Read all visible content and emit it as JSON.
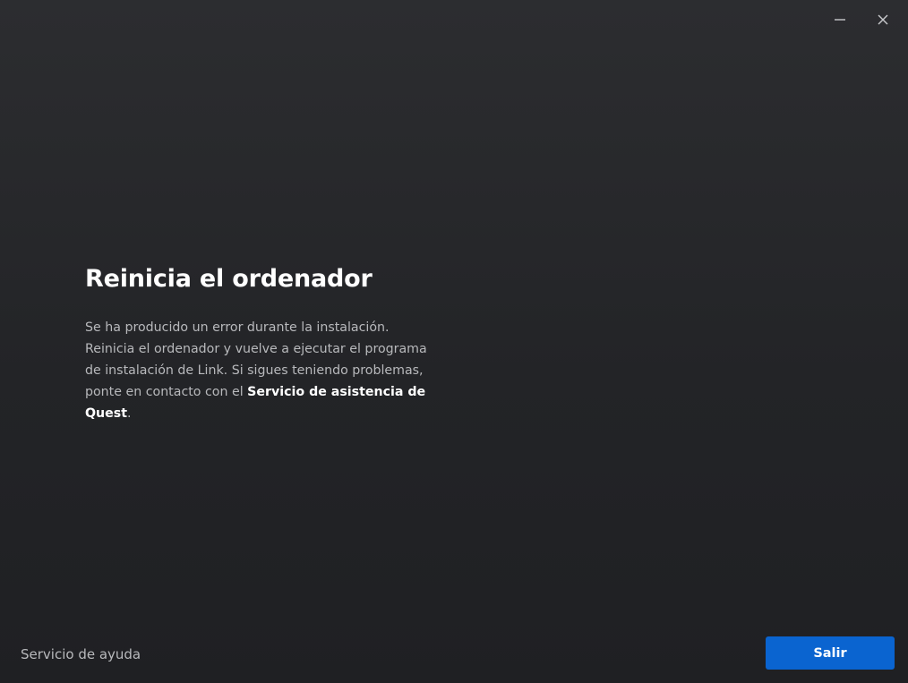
{
  "window": {
    "minimize_icon": "minimize-icon",
    "close_icon": "close-icon"
  },
  "main": {
    "title": "Reinicia el ordenador",
    "body_text": "Se ha producido un error durante la instalación. Reinicia el ordenador y vuelve a ejecutar el programa de instalación de Link. Si sigues teniendo problemas, ponte en contacto con el ",
    "support_link": "Servicio de asistencia de Quest",
    "body_suffix": "."
  },
  "footer": {
    "help_link": "Servicio de ayuda",
    "exit_button": "Salir"
  },
  "colors": {
    "accent": "#0a64d0",
    "background": "#26272a",
    "text_secondary": "#b8b9bc"
  }
}
